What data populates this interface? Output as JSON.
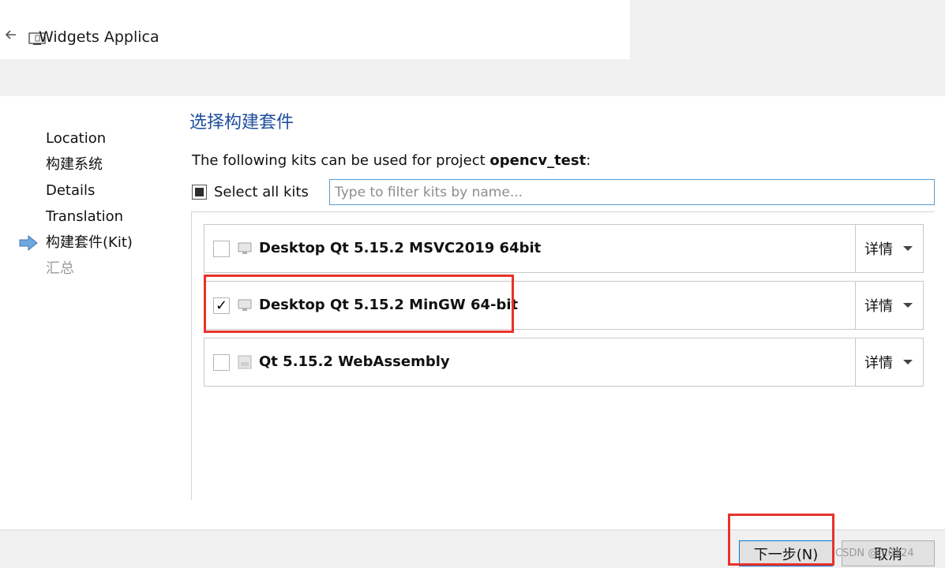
{
  "window": {
    "title": "Widgets Applicati"
  },
  "sidebar": {
    "steps": [
      {
        "label": "Location"
      },
      {
        "label": "构建系统"
      },
      {
        "label": "Details"
      },
      {
        "label": "Translation"
      },
      {
        "label": "构建套件(Kit)",
        "current": true
      },
      {
        "label": "汇总",
        "dim": true
      }
    ]
  },
  "page": {
    "heading": "选择构建套件",
    "intro_prefix": "The following kits can be used for project ",
    "project_name": "opencv_test",
    "intro_suffix": ":",
    "select_all_label": "Select all kits",
    "filter_placeholder": "Type to filter kits by name..."
  },
  "kits": [
    {
      "name": "Desktop Qt 5.15.2 MSVC2019 64bit",
      "checked": false,
      "details_label": "详情",
      "icon": "desktop-icon"
    },
    {
      "name": "Desktop Qt 5.15.2 MinGW 64-bit",
      "checked": true,
      "check_mark": "✓",
      "details_label": "详情",
      "icon": "desktop-icon"
    },
    {
      "name": "Qt 5.15.2 WebAssembly",
      "checked": false,
      "details_label": "详情",
      "icon": "webassembly-icon"
    }
  ],
  "buttons": {
    "next_label": "下一步(N)",
    "cancel_label": "取消"
  },
  "watermark": "CSDN @...0124",
  "colors": {
    "heading": "#1f4e9c",
    "highlight": "#e8322a",
    "focus_border": "#5a9bd5"
  }
}
